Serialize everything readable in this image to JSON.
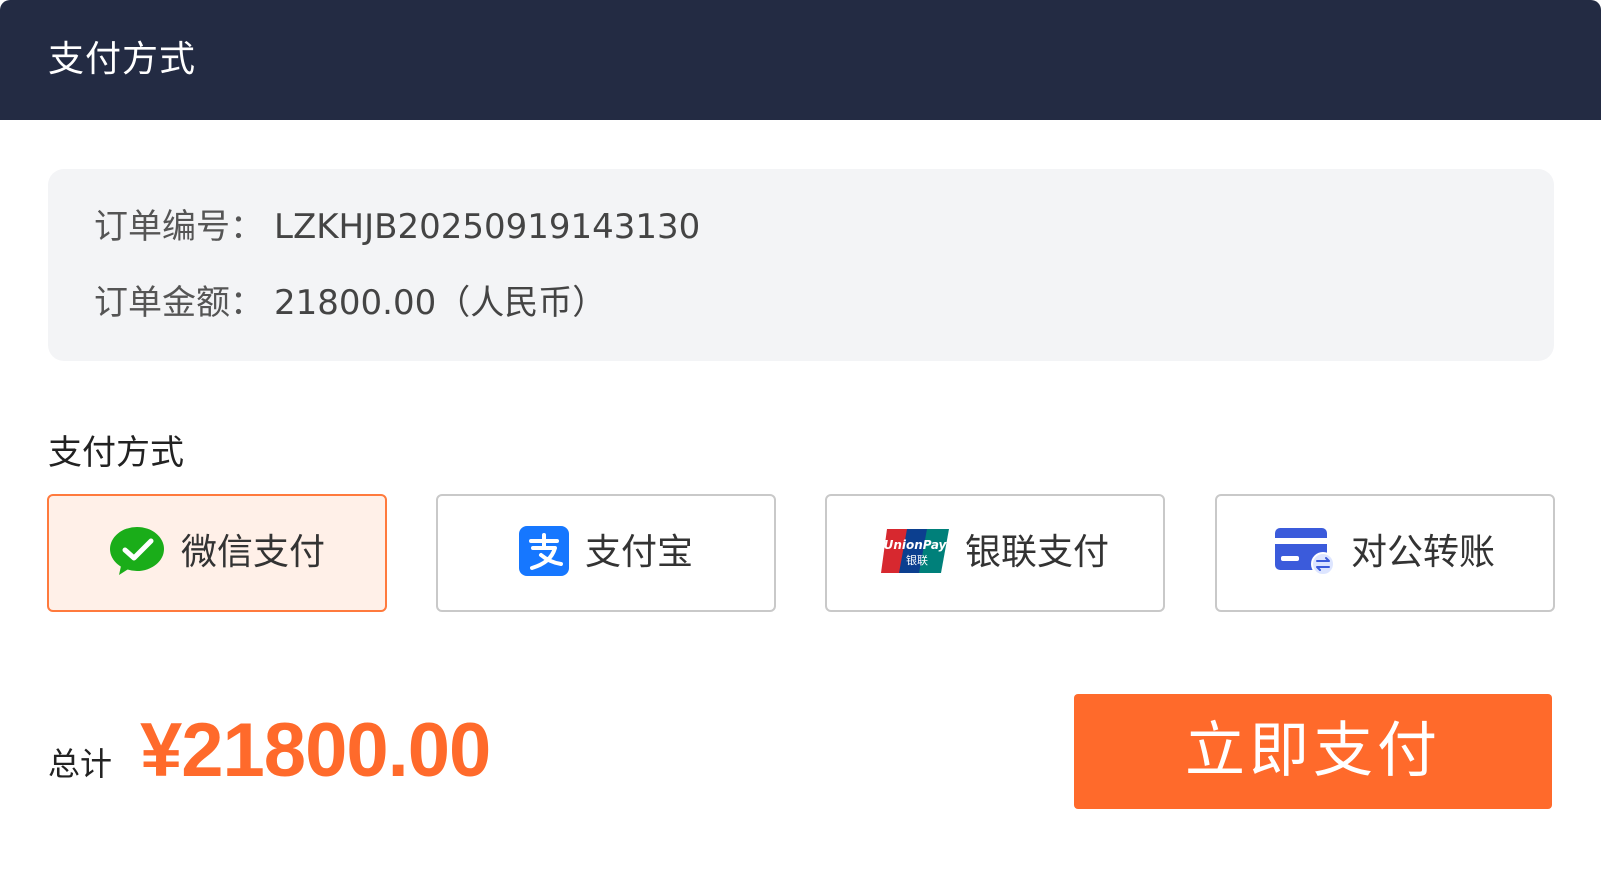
{
  "header": {
    "title": "支付方式"
  },
  "order": {
    "number_label": "订单编号：",
    "number_value": "LZKHJB20250919143130",
    "amount_label": "订单金额：",
    "amount_value": "21800.00（人民币）"
  },
  "payment": {
    "section_title": "支付方式",
    "selected": "wechat",
    "methods": [
      {
        "id": "wechat",
        "label": "微信支付",
        "icon": "wechat-pay-icon",
        "color": "#1aad19"
      },
      {
        "id": "alipay",
        "label": "支付宝",
        "icon": "alipay-icon",
        "color": "#1677ff"
      },
      {
        "id": "unionpay",
        "label": "银联支付",
        "icon": "unionpay-icon",
        "color": "#d7282f"
      },
      {
        "id": "transfer",
        "label": "对公转账",
        "icon": "bank-transfer-icon",
        "color": "#3b5bdb"
      }
    ]
  },
  "footer": {
    "total_label": "总计",
    "total_amount": "¥21800.00",
    "pay_button_label": "立即支付"
  },
  "colors": {
    "header_bg": "#232b43",
    "accent": "#ff6a2b",
    "selected_bg": "#fff0e8"
  }
}
